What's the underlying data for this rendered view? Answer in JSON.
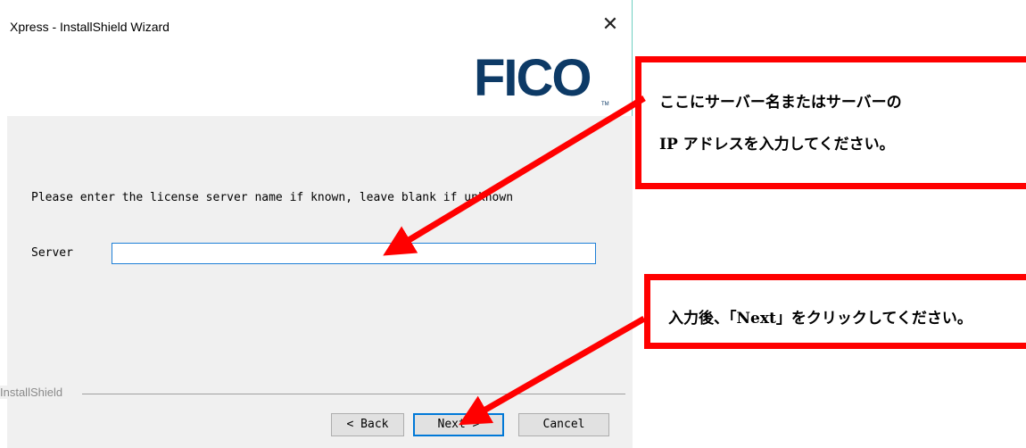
{
  "window": {
    "title": "Xpress - InstallShield Wizard",
    "close_glyph": "✕"
  },
  "logo": {
    "text": "FICO",
    "trademark": "TM"
  },
  "content": {
    "prompt": "Please enter the license server name if known, leave blank if unknown",
    "server_label": "Server",
    "server_value": "",
    "server_placeholder": ""
  },
  "footer": {
    "brand": "InstallShield",
    "back_label": "< Back",
    "next_label": "Next >",
    "cancel_label": "Cancel"
  },
  "annotations": {
    "callout_1_line_1": "ここにサーバー名またはサーバーの",
    "callout_1_line_2": "IP アドレスを入力してください。",
    "callout_2": "入力後、「Next」をクリックしてください。",
    "accent_color": "#ff0000"
  }
}
